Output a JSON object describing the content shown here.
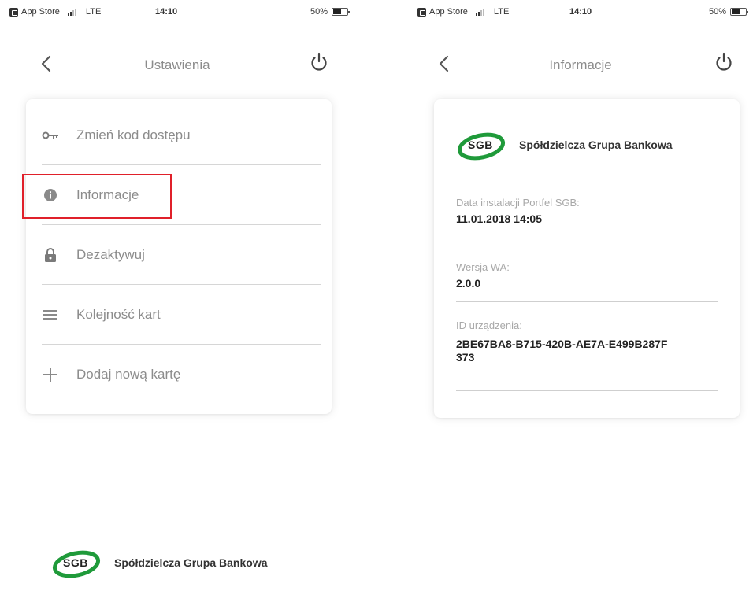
{
  "status_bar": {
    "carrier": "App Store",
    "network": "LTE",
    "time": "14:10",
    "battery": "50%"
  },
  "settings_screen": {
    "title": "Ustawienia",
    "items": [
      {
        "label": "Zmień kod dostępu",
        "icon": "key-icon"
      },
      {
        "label": "Informacje",
        "icon": "info-icon"
      },
      {
        "label": "Dezaktywuj",
        "icon": "lock-icon"
      },
      {
        "label": "Kolejność kart",
        "icon": "menu-lines-icon"
      },
      {
        "label": "Dodaj nową kartę",
        "icon": "plus-icon"
      }
    ]
  },
  "info_screen": {
    "title": "Informacje",
    "logo": {
      "mark": "SGB",
      "name": "Spółdzielcza Grupa Bankowa"
    },
    "fields": [
      {
        "label": "Data instalacji Portfel SGB:",
        "value": "11.01.2018 14:05"
      },
      {
        "label": "Wersja WA:",
        "value": "2.0.0"
      },
      {
        "label": "ID urządzenia:",
        "value": "2BE67BA8-B715-420B-AE7A-E499B287F373"
      }
    ]
  },
  "footer_logo": {
    "mark": "SGB",
    "name": "Spółdzielcza Grupa Bankowa"
  },
  "colors": {
    "highlight": "#e0202a",
    "logo_green": "#1f9a3a",
    "muted_text": "#8c8c8c"
  }
}
